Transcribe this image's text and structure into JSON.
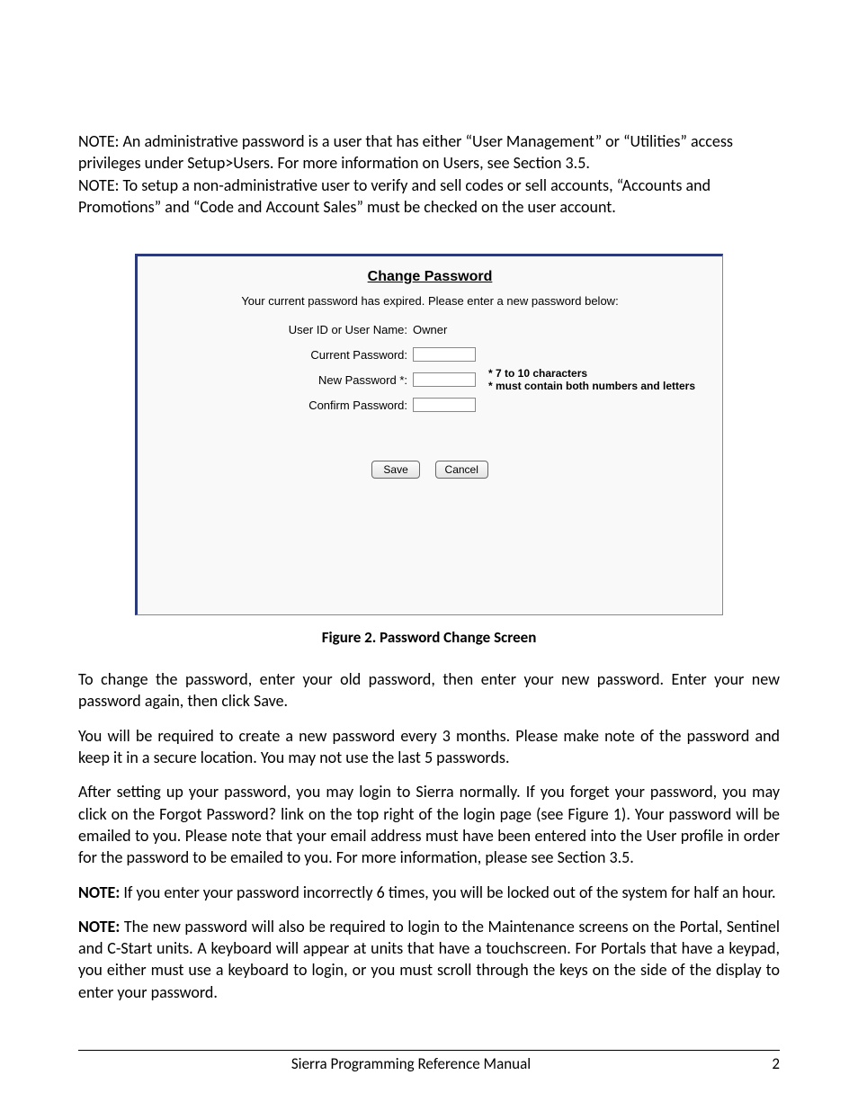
{
  "paragraphs": {
    "p1": "NOTE: An administrative password is a user that has either “User Management” or “Utilities” access privileges under Setup>Users. For more information on Users, see Section 3.5.",
    "p2": "NOTE: To setup a non-administrative user to verify and sell codes or sell accounts, “Accounts and Promotions” and “Code and Account Sales” must be checked on the user account.",
    "p3": "To change the password, enter your old password, then enter your new password. Enter your new password again, then click Save.",
    "p4": "You will be required to create a new password every 3 months. Please make note of the password and keep it in a secure location. You may not use the last 5 passwords.",
    "p5": "After setting up your password, you may login to Sierra normally. If you forget your password, you may click on the Forgot Password? link on the top right of the login page (see Figure 1). Your password will be emailed to you. Please note that your email address must have been entered into the User profile in order for the password to be emailed to you. For more information, please see Section 3.5.",
    "note1_label": "NOTE:",
    "note1_text": " If you enter your password incorrectly 6 times, you will be locked out of the system for half an hour.",
    "note2_label": "NOTE:",
    "note2_text": " The new password will also be required to login to the Maintenance screens on the Portal, Sentinel and C-Start units. A keyboard will appear at units that have a touchscreen. For Portals that have a keypad, you either must use a keyboard to login, or you must scroll through the keys on the side of the display to enter your password."
  },
  "figure": {
    "title": "Change Password",
    "message": "Your current password has expired. Please enter a new password below:",
    "rows": {
      "user_label": "User ID or User Name:",
      "user_value": "Owner",
      "current_label": "Current Password:",
      "new_label": "New Password *:",
      "confirm_label": "Confirm Password:"
    },
    "hints": {
      "h1": "* 7 to 10 characters",
      "h2": "* must contain both numbers and letters"
    },
    "buttons": {
      "save": "Save",
      "cancel": "Cancel"
    },
    "caption": "Figure 2. Password Change Screen"
  },
  "footer": {
    "title": "Sierra Programming Reference Manual",
    "page": "2"
  }
}
